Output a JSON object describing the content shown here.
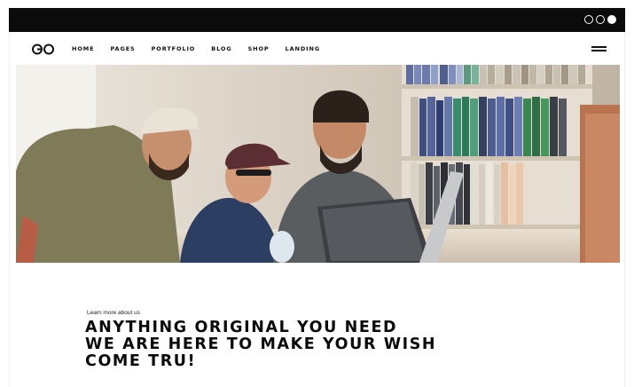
{
  "window": {
    "controls": [
      "circle-outline-icon",
      "circle-outline-icon",
      "circle-filled-icon"
    ]
  },
  "header": {
    "logo": "GO",
    "nav": [
      "HOME",
      "PAGES",
      "PORTFOLIO",
      "BLOG",
      "SHOP",
      "LANDING"
    ],
    "menu_icon": "hamburger-icon"
  },
  "hero": {
    "image": "Group of smiling young men in caps gathered around a laptop in front of a bookshelf"
  },
  "intro": {
    "eyebrow": "Learn more about us",
    "headline": [
      "ANYTHING ORIGINAL YOU NEED",
      "WE ARE HERE TO MAKE YOUR WISH",
      "COME TRU!"
    ]
  },
  "colors": {
    "frame": "#0b0b0b",
    "text": "#111111",
    "background": "#ffffff"
  }
}
